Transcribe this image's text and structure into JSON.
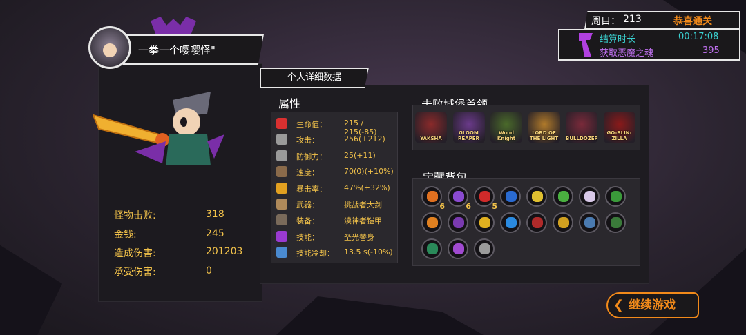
{
  "player": {
    "name": "一拳一个嘤嘤怪\""
  },
  "detail_tab": {
    "label": "个人详细数据"
  },
  "summary_stats": [
    {
      "label": "怪物击败:",
      "value": "318"
    },
    {
      "label": "金钱:",
      "value": "245"
    },
    {
      "label": "造成伤害:",
      "value": "201203"
    },
    {
      "label": "承受伤害:",
      "value": "0"
    }
  ],
  "attributes": {
    "title": "属性",
    "rows": [
      {
        "icon": "heart-icon",
        "label": "生命值：",
        "value": "215 / 215(-85)",
        "color": "#d93030"
      },
      {
        "icon": "sword-icon",
        "label": "攻击：",
        "value": "256(+212)",
        "color": "#9a9a9a"
      },
      {
        "icon": "shield-icon",
        "label": "防御力：",
        "value": "25(+11)",
        "color": "#9a9a9a"
      },
      {
        "icon": "boot-icon",
        "label": "速度：",
        "value": "70(0)(+10%)",
        "color": "#8a6a4a"
      },
      {
        "icon": "crit-icon",
        "label": "暴击率：",
        "value": "47%(+32%)",
        "color": "#e2a020"
      },
      {
        "icon": "weapon-icon",
        "label": "武器：",
        "value": "挑战者大剑",
        "color": "#b08a5a"
      },
      {
        "icon": "armor-icon",
        "label": "装备：",
        "value": "渎神者铠甲",
        "color": "#7a6a5a"
      },
      {
        "icon": "skill-icon",
        "label": "技能：",
        "value": "圣光替身",
        "color": "#9a3ad0"
      },
      {
        "icon": "cooldown-icon",
        "label": "技能冷却：",
        "value": "13.5 s(-10%)",
        "color": "#4a8ad0"
      }
    ]
  },
  "bosses": {
    "title": "击败城堡首领",
    "items": [
      {
        "name": "YAKSHA",
        "color": "#8a2a2a"
      },
      {
        "name": "GLOOM REAPER",
        "color": "#6a3a8a"
      },
      {
        "name": "Wood Knight",
        "color": "#4a6a2a"
      },
      {
        "name": "LORD OF THE LIGHT",
        "color": "#b07a2a"
      },
      {
        "name": "BULLDOZER",
        "color": "#7a2a3a"
      },
      {
        "name": "GO-BLIN-ZILLA",
        "color": "#8a1a1a"
      }
    ]
  },
  "treasure": {
    "title": "宝藏背包",
    "items": [
      {
        "icon": "fire-gem-icon",
        "color": "#e07020",
        "count": "6"
      },
      {
        "icon": "crystal-gem-icon",
        "color": "#8a4ad0",
        "count": "6"
      },
      {
        "icon": "ruby-gem-icon",
        "color": "#d02a2a",
        "count": "5"
      },
      {
        "icon": "sapphire-gem-icon",
        "color": "#2a6ad0",
        "count": ""
      },
      {
        "icon": "gold-leaf-icon",
        "color": "#e0c030",
        "count": ""
      },
      {
        "icon": "green-potion-icon",
        "color": "#4ab040",
        "count": ""
      },
      {
        "icon": "bone-icon",
        "color": "#d8c8e8",
        "count": ""
      },
      {
        "icon": "green-beast-icon",
        "color": "#3a9a3a",
        "count": ""
      },
      {
        "icon": "orange-dragon-icon",
        "color": "#e08020",
        "count": ""
      },
      {
        "icon": "purple-claw-icon",
        "color": "#7a3ab0",
        "count": ""
      },
      {
        "icon": "gold-shield-icon",
        "color": "#e0b020",
        "count": ""
      },
      {
        "icon": "blue-flame-icon",
        "color": "#2a8ae0",
        "count": ""
      },
      {
        "icon": "red-claw-icon",
        "color": "#b02a2a",
        "count": ""
      },
      {
        "icon": "gold-skull-icon",
        "color": "#d0a020",
        "count": ""
      },
      {
        "icon": "blue-armor-icon",
        "color": "#4a7ab0",
        "count": ""
      },
      {
        "icon": "green-armor-icon",
        "color": "#3a7a3a",
        "count": ""
      },
      {
        "icon": "green-boot-icon",
        "color": "#2a8a5a",
        "count": ""
      },
      {
        "icon": "purple-blade-icon",
        "color": "#a04ad0",
        "count": ""
      },
      {
        "icon": "gray-chain-icon",
        "color": "#9a9a9a",
        "count": ""
      }
    ]
  },
  "top_right": {
    "round_label": "周目：",
    "round_value": "213",
    "clear_text": "恭喜通关",
    "time_label": "结算时长",
    "time_value": "00:17:08",
    "souls_label": "获取恶魔之魂",
    "souls_value": "395"
  },
  "continue_button": {
    "label": "继续游戏"
  },
  "colors": {
    "accent": "#f28a1a",
    "gold_text": "#f2c24a",
    "purple": "#a040d0",
    "cyan": "#3ad0d0"
  }
}
